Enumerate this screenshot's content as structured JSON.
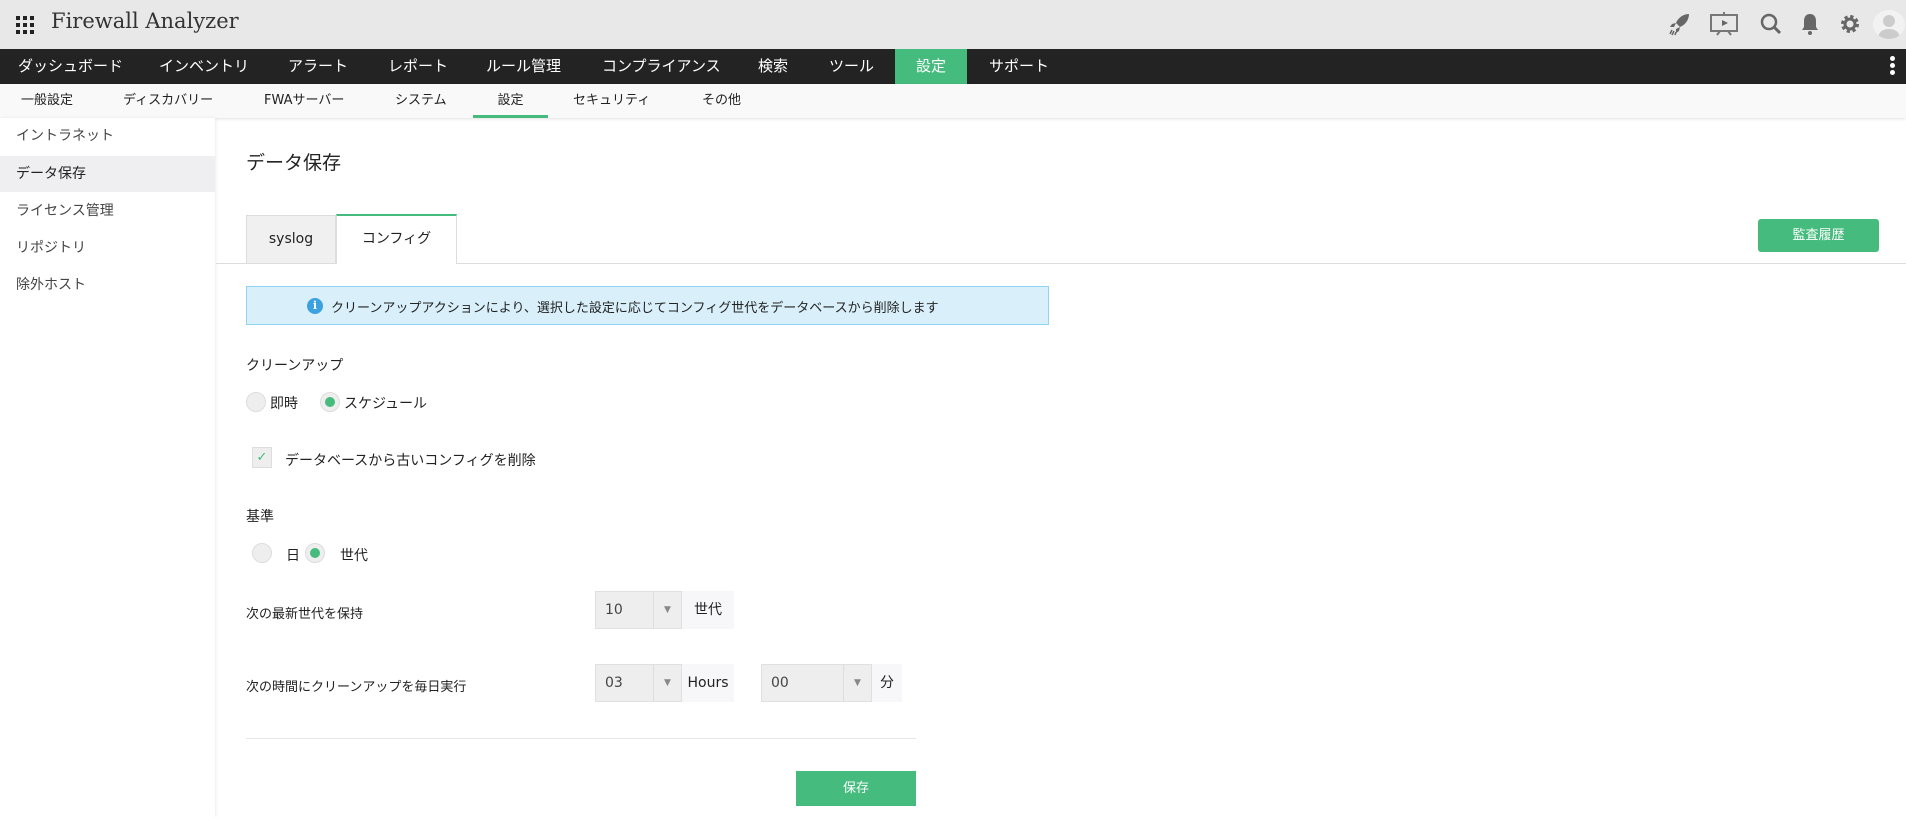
{
  "header": {
    "app_title": "Firewall Analyzer",
    "icons": [
      "apps-grid-icon",
      "rocket-icon",
      "presentation-icon",
      "search-icon",
      "bell-icon",
      "gear-icon",
      "user-avatar-icon"
    ]
  },
  "nav": {
    "items": [
      "ダッシュボード",
      "インベントリ",
      "アラート",
      "レポート",
      "ルール管理",
      "コンプライアンス",
      "検索",
      "ツール",
      "設定",
      "サポート"
    ],
    "active": "設定"
  },
  "subnav": {
    "items": [
      "一般設定",
      "ディスカバリー",
      "FWAサーバー",
      "システム",
      "設定",
      "セキュリティ",
      "その他"
    ],
    "active": "設定"
  },
  "sidebar": {
    "items": [
      "イントラネット",
      "データ保存",
      "ライセンス管理",
      "リポジトリ",
      "除外ホスト"
    ],
    "active": "データ保存"
  },
  "main": {
    "title": "データ保存",
    "tabs": [
      "syslog",
      "コンフィグ"
    ],
    "active_tab": "コンフィグ",
    "audit_button": "監査履歴",
    "info": "クリーンアップアクションにより、選択した設定に応じてコンフィグ世代をデータベースから削除します",
    "cleanup": {
      "label": "クリーンアップ",
      "options": [
        "即時",
        "スケジュール"
      ],
      "selected": "スケジュール"
    },
    "delete_old": {
      "label": "データベースから古いコンフィグを削除",
      "checked": true
    },
    "criteria": {
      "label": "基準",
      "options": [
        "日",
        "世代"
      ],
      "selected": "世代"
    },
    "keep": {
      "label": "次の最新世代を保持",
      "value": "10",
      "unit": "世代"
    },
    "schedule": {
      "label": "次の時間にクリーンアップを毎日実行",
      "hours": "03",
      "hours_unit": "Hours",
      "minutes": "00",
      "minutes_unit": "分"
    },
    "save_button": "保存"
  },
  "colors": {
    "accent": "#45bb7d",
    "nav_bg": "#232323",
    "info_bg": "#d9f0fb",
    "info_border": "#8fd3f5"
  }
}
